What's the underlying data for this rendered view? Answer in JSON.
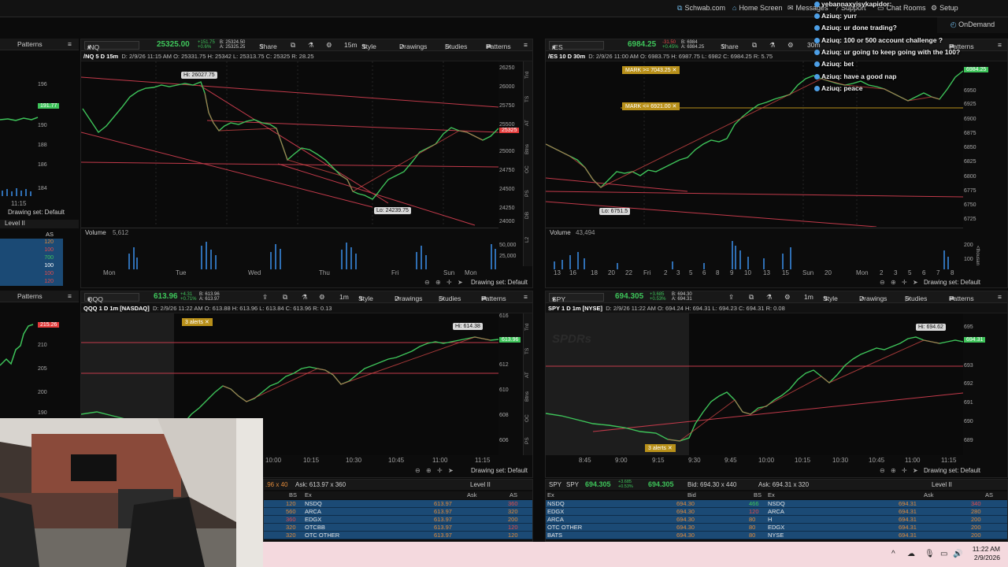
{
  "topbar": {
    "schwab": "Schwab.com",
    "home": "Home Screen",
    "messages": "Messages",
    "support": "Support",
    "chat_rooms": "Chat Rooms",
    "setup": "Setup",
    "ondemand": "OnDemand"
  },
  "chat": {
    "top_user": "yebannaxyisykapidor:",
    "lines": [
      {
        "user": "Aziuq:",
        "text": "yurr"
      },
      {
        "user": "Aziuq:",
        "text": "ur done trading?"
      },
      {
        "user": "Aziuq:",
        "text": "100 or 500 account challenge ?"
      },
      {
        "user": "Aziuq:",
        "text": "ur going to keep going with the 100?"
      },
      {
        "user": "Aziuq:",
        "text": "bet"
      },
      {
        "user": "Aziuq:",
        "text": "have a good nap"
      },
      {
        "user": "Aziuq:",
        "text": "peace"
      }
    ]
  },
  "toolbar_labels": {
    "share": "Share",
    "style": "Style",
    "drawings": "Drawings",
    "studies": "Studies",
    "patterns": "Patterns",
    "drawing_set": "Drawing set: Default"
  },
  "side_tabs": [
    "Trd",
    "TS",
    "AT",
    "Btns",
    "OC",
    "PS",
    "DB",
    "L2"
  ],
  "nq": {
    "symbol": "/NQ",
    "price": "25325.00",
    "chg1": "+151.75",
    "chg2": "+0.6%",
    "bid": "B: 25324.50",
    "ask": "A: 25325.25",
    "interval": "15m",
    "header_sym": "/NQ 5 D 15m",
    "header_rest": "D: 2/9/26 11:15 AM  O: 25331.75  H: 25342  L: 25313.75  C: 25325  R: 28.25",
    "hi_label": "Hi: 26027.75",
    "lo_label": "Lo: 24239.75",
    "price_tag": "25325",
    "volume_label": "Volume",
    "volume_value": "5,612",
    "y_ticks": [
      "26250",
      "26000",
      "25750",
      "25500",
      "25250",
      "25000",
      "24750",
      "24500",
      "24250",
      "24000"
    ],
    "vol_ticks": [
      "50,000",
      "25,000"
    ],
    "x_ticks": [
      "Mon",
      "Tue",
      "Wed",
      "Thu",
      "Fri",
      "Sun",
      "Mon"
    ]
  },
  "es": {
    "symbol": "/ES",
    "price": "6984.25",
    "chg1": "-31.50",
    "chg2": "+0.45%",
    "bid": "B: 6984",
    "ask": "A: 6984.25",
    "interval": "30m",
    "header_sym": "/ES 10 D 30m",
    "header_rest": "D: 2/9/26 11:00 AM  O: 6983.75  H: 6987.75  L: 6982  C: 6984.25  R: 5.75",
    "mark1": "MARK >= 7043.25",
    "mark2": "MARK <= 6921.00",
    "lo_label": "Lo: 6751.5",
    "price_tag": "6984.25",
    "volume_label": "Volume",
    "volume_value": "43,494",
    "y_ticks": [
      "6975",
      "6950",
      "6925",
      "6900",
      "6875",
      "6850",
      "6825",
      "6800",
      "6775",
      "6750",
      "6725"
    ],
    "vol_ticks": [
      "200",
      "100"
    ],
    "vol_unit": "<thousan",
    "x_ticks": [
      "13",
      "16",
      "18",
      "20",
      "22",
      "Fri",
      "2",
      "3",
      "5",
      "6",
      "8",
      "9",
      "10",
      "13",
      "15",
      "Sun",
      "20",
      "Mon",
      "2",
      "3",
      "5",
      "6",
      "7",
      "8",
      "10"
    ]
  },
  "qqq": {
    "symbol": "QQQ",
    "price": "613.96",
    "chg1": "+4.31",
    "chg2": "+0.71%",
    "bid": "B: 613.96",
    "ask": "A: 613.97",
    "interval": "1m",
    "header_sym": "QQQ 1 D 1m [NASDAQ]",
    "header_rest": "D: 2/9/26 11:22 AM  O: 613.88  H: 613.96  L: 613.84  C: 613.96  R: 0.13",
    "alerts": "3 alerts",
    "hi_label": "Hi: 614.38",
    "price_tag": "613.96",
    "y_ticks": [
      "616",
      "614",
      "612",
      "610",
      "608",
      "606"
    ],
    "x_ticks": [
      "10:00",
      "10:15",
      "10:30",
      "10:45",
      "11:00",
      "11:15"
    ]
  },
  "spy": {
    "symbol": "SPY",
    "price": "694.305",
    "chg1": "+3.685",
    "chg2": "+0.53%",
    "bid": "B: 694.30",
    "ask": "A: 694.31",
    "interval": "1m",
    "header_sym": "SPY 1 D 1m [NYSE]",
    "header_rest": "D: 2/9/26 11:22 AM  O: 694.24  H: 694.31  L: 694.23  C: 694.31  R: 0.08",
    "watermark": "SPDRs",
    "alerts": "3 alerts",
    "hi_label": "Hi: 694.62",
    "price_tag": "694.31",
    "y_ticks": [
      "695",
      "694",
      "693",
      "692",
      "691",
      "690",
      "689"
    ],
    "x_ticks": [
      "8:45",
      "9:00",
      "9:15",
      "9:30",
      "9:45",
      "10:00",
      "10:15",
      "10:30",
      "10:45",
      "11:00",
      "11:15"
    ]
  },
  "left_slice_top": {
    "y_ticks": [
      "196",
      "194",
      "192",
      "190",
      "188",
      "186",
      "184"
    ],
    "price_tag": "191.77",
    "x_tick": "11:15",
    "drawing_set": "Drawing set: Default",
    "level2": "Level II",
    "as_label": "AS",
    "as_values": [
      "120",
      "100",
      "700",
      "100",
      "100",
      "120"
    ]
  },
  "left_slice_bottom": {
    "price_tag": "215.26",
    "y_ticks": [
      "210",
      "205",
      "200",
      "195",
      "190"
    ]
  },
  "qqq_l2": {
    "ask_line": "Ask: 613.97 x 360",
    "bid_prefix": ".96 x 40",
    "title": "Level II",
    "headers": {
      "bs": "BS",
      "ex": "Ex",
      "ask": "Ask",
      "as": "AS"
    },
    "rows": [
      {
        "bs": "120",
        "ex": "NSDQ",
        "ask": "613.97",
        "as": "360"
      },
      {
        "bs": "560",
        "ex": "ARCA",
        "ask": "613.97",
        "as": "320"
      },
      {
        "bs": "360",
        "ex": "EDGX",
        "ask": "613.97",
        "as": "200"
      },
      {
        "bs": "320",
        "ex": "OTCBB",
        "ask": "613.97",
        "as": "120"
      },
      {
        "bs": "320",
        "ex": "OTC OTHER",
        "ask": "613.97",
        "as": "120"
      }
    ]
  },
  "spy_l2": {
    "sym1": "SPY",
    "sym2": "SPY",
    "price1": "694.305",
    "price2": "694.305",
    "chg1": "+3.685",
    "chg2": "+0.53%",
    "bid": "Bid: 694.30 x 440",
    "ask": "Ask: 694.31 x 320",
    "title": "Level II",
    "headers": {
      "ex": "Ex",
      "bid": "Bid",
      "bs": "BS",
      "ex2": "Ex",
      "ask": "Ask",
      "as": "AS"
    },
    "rows": [
      {
        "ex": "NSDQ",
        "bid": "694.30",
        "bs": "466",
        "ex2": "NSDQ",
        "ask": "694.31",
        "as": "340"
      },
      {
        "ex": "EDGX",
        "bid": "694.30",
        "bs": "120",
        "ex2": "ARCA",
        "ask": "694.31",
        "as": "280"
      },
      {
        "ex": "ARCA",
        "bid": "694.30",
        "bs": "80",
        "ex2": "H",
        "ask": "694.31",
        "as": "200"
      },
      {
        "ex": "OTC OTHER",
        "bid": "694.30",
        "bs": "80",
        "ex2": "EDGX",
        "ask": "694.31",
        "as": "200"
      },
      {
        "ex": "BATS",
        "bid": "694.30",
        "bs": "80",
        "ex2": "NYSE",
        "ask": "694.31",
        "as": "200"
      }
    ]
  },
  "taskbar": {
    "time": "11:22 AM",
    "date": "2/9/2026"
  },
  "colors": {
    "up": "#3ec45a",
    "down": "#e34b4b",
    "trendline": "#c23a4a",
    "l2_row": "#1b4a75",
    "alert": "#b8901a"
  }
}
